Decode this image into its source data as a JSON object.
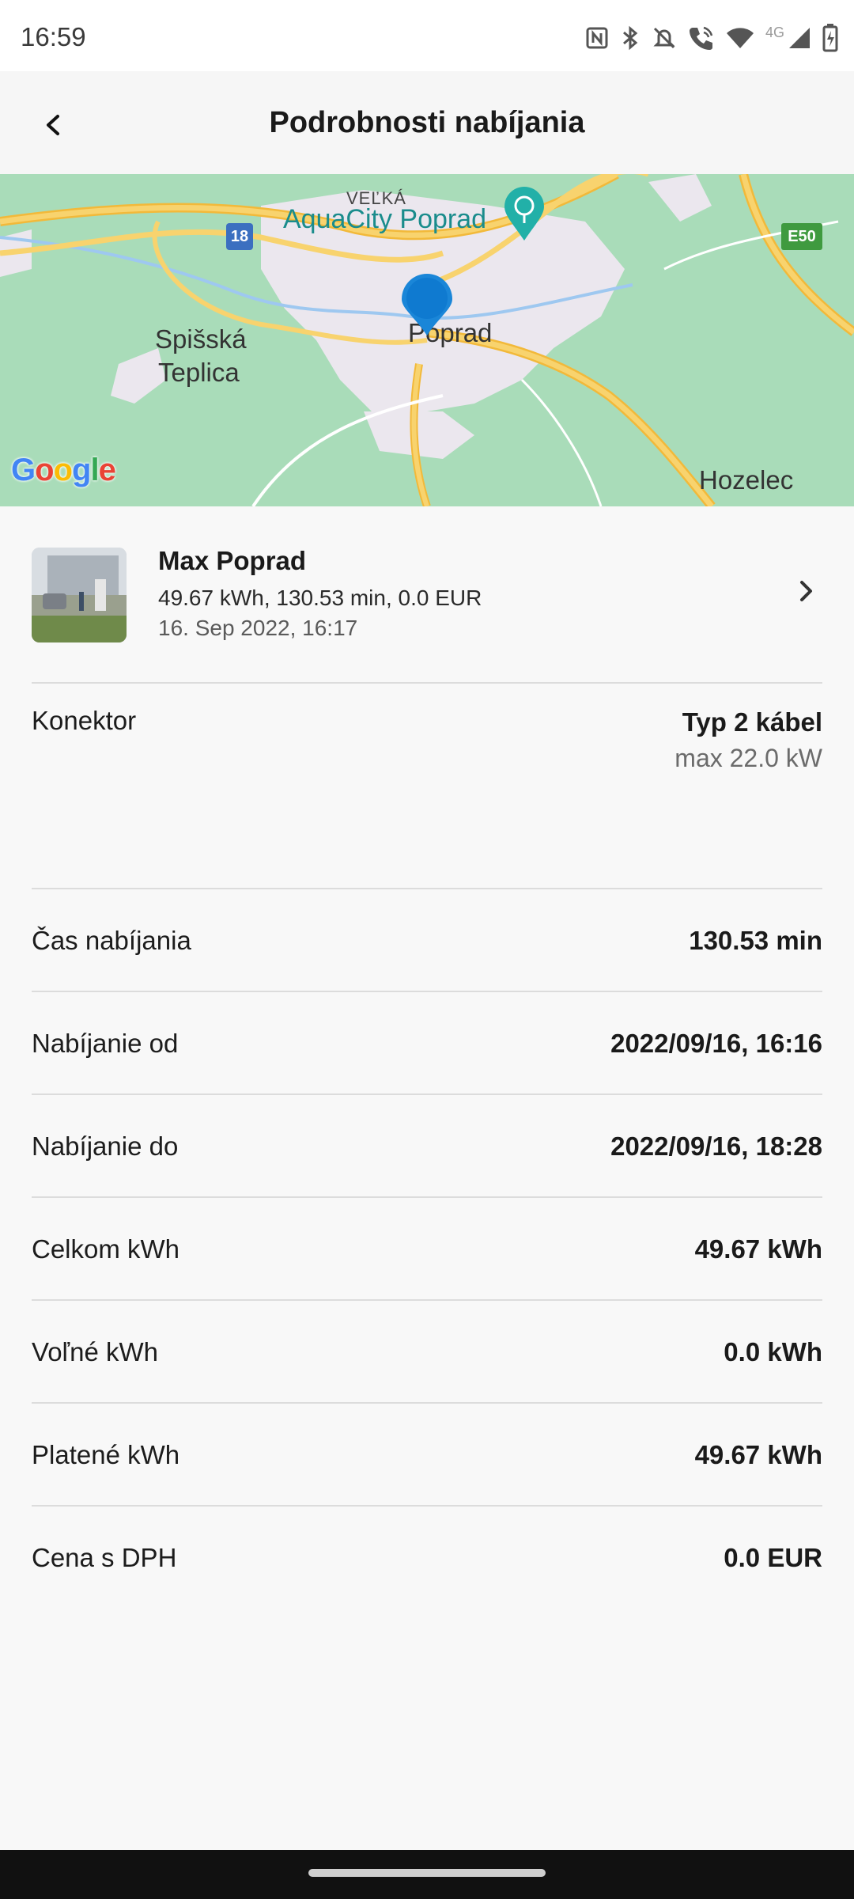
{
  "status_bar": {
    "time": "16:59",
    "network_label": "4G",
    "icons": [
      "nfc-icon",
      "bluetooth-icon",
      "mute-icon",
      "wifi-call-icon",
      "wifi-icon",
      "signal-icon",
      "battery-charging-icon"
    ]
  },
  "header": {
    "title": "Podrobnosti nabíjania",
    "back_icon": "back-arrow-icon"
  },
  "map": {
    "labels": {
      "velka": "VEĽKÁ",
      "aquacity": "AquaCity Poprad",
      "spisska": "Spišská",
      "teplica": "Teplica",
      "poprad": "Poprad",
      "hozelec": "Hozelec",
      "route_18": "18",
      "route_e50": "E50"
    },
    "attribution": "Google",
    "colors": {
      "land": "#a8dcb8",
      "urban": "#ece8ee",
      "road": "#f6c64e",
      "pin": "#1a86d8"
    }
  },
  "station": {
    "name": "Max Poprad",
    "summary": "49.67 kWh, 130.53 min, 0.0 EUR",
    "date": "16. Sep 2022, 16:17"
  },
  "connector": {
    "label": "Konektor",
    "type": "Typ 2 kábel",
    "power": "max 22.0 kW"
  },
  "details": [
    {
      "label": "Čas nabíjania",
      "value": "130.53 min"
    },
    {
      "label": "Nabíjanie od",
      "value": "2022/09/16, 16:16"
    },
    {
      "label": "Nabíjanie do",
      "value": "2022/09/16, 18:28"
    },
    {
      "label": "Celkom kWh",
      "value": "49.67 kWh"
    },
    {
      "label": "Voľné kWh",
      "value": "0.0 kWh"
    },
    {
      "label": "Platené kWh",
      "value": "49.67 kWh"
    },
    {
      "label": "Cena s DPH",
      "value": "0.0 EUR"
    }
  ]
}
